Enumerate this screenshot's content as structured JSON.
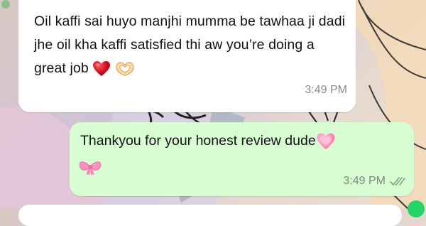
{
  "chat": {
    "incoming": {
      "text": "Oil kaffi sai huyo manjhi mumma be tawhaa ji dadi jhe oil kha kaffi satisfied thi aw you’re doing a great job",
      "emojis": [
        "red-heart",
        "heart-hands"
      ],
      "time": "3:49 PM"
    },
    "outgoing": {
      "text": "Thankyou for your honest review dude",
      "emojis": [
        "pink-heart",
        "ribbon-bow"
      ],
      "time": "3:49 PM",
      "status": "read-ticks"
    }
  },
  "colors": {
    "incoming_bubble": "#ffffff",
    "outgoing_bubble": "#d9fdd3",
    "timestamp": "#8a8a8a",
    "online_dot": "#25d366"
  }
}
